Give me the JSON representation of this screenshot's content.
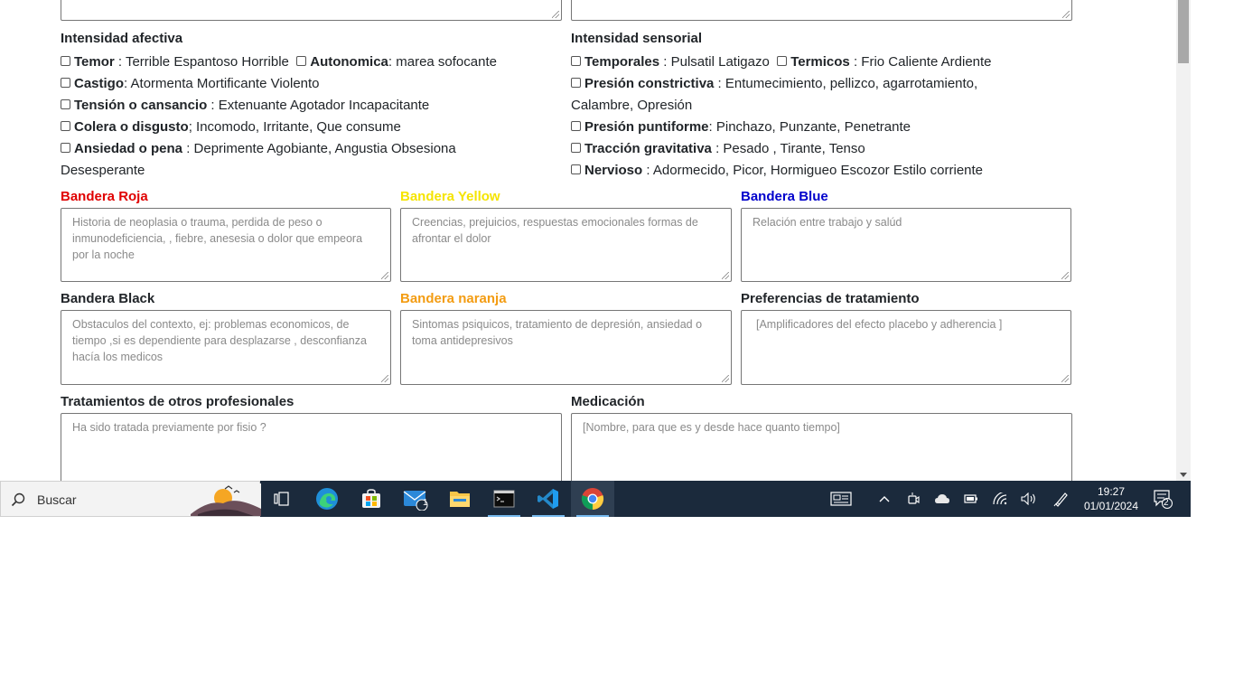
{
  "colors": {
    "red": "#e00000",
    "yellow": "#f5e400",
    "blue": "#0000cc",
    "orange": "#f39c12",
    "taskbar": "#1b2a3c"
  },
  "form": {
    "afectiva": {
      "title": "Intensidad afectiva",
      "items": [
        {
          "name": "Temor",
          "desc": " : Terrible Espantoso Horrible"
        },
        {
          "name": "Autonomica",
          "desc": ": marea sofocante"
        },
        {
          "name": "Castigo",
          "desc": ": Atormenta Mortificante Violento"
        },
        {
          "name": "Tensión o cansancio",
          "desc": " : Extenuante Agotador Incapacitante"
        },
        {
          "name": "Colera o disgusto",
          "desc": "; Incomodo, Irritante, Que consume"
        },
        {
          "name": "Ansiedad o pena",
          "desc": " : Deprimente Agobiante, Angustia Obsesiona"
        }
      ],
      "continuation": "Desesperante"
    },
    "sensorial": {
      "title": "Intensidad sensorial",
      "items": [
        {
          "name": "Temporales",
          "desc": " : Pulsatil Latigazo"
        },
        {
          "name": "Termicos",
          "desc": " : Frio Caliente Ardiente"
        },
        {
          "name": "Presión constrictiva",
          "desc": " : Entumecimiento, pellizco, agarrotamiento,"
        },
        {
          "name": "Presión puntiforme",
          "desc": ": Pinchazo, Punzante, Penetrante"
        },
        {
          "name": "Tracción gravitativa",
          "desc": " : Pesado , Tirante, Tenso"
        },
        {
          "name": "Nervioso",
          "desc": " : Adormecido, Picor, Hormigueo Escozor Estilo corriente"
        }
      ],
      "continuation": "Calambre, Opresión"
    },
    "bandera_roja": {
      "label": "Bandera Roja",
      "placeholder": "Historia de neoplasia o trauma, perdida de peso o inmunodeficiencia, , fiebre, anesesia o dolor que empeora por la noche"
    },
    "bandera_yellow": {
      "label": "Bandera Yellow",
      "placeholder": "Creencias, prejuicios, respuestas emocionales formas de afrontar el dolor"
    },
    "bandera_blue": {
      "label": "Bandera Blue",
      "placeholder": "Relación entre trabajo y salúd"
    },
    "bandera_black": {
      "label": "Bandera Black",
      "placeholder": "Obstaculos del contexto, ej:  problemas economicos, de tiempo ,si es dependiente para desplazarse , desconfianza hacía los medicos"
    },
    "bandera_naranja": {
      "label": "Bandera naranja",
      "placeholder": "Sintomas psiquicos, tratamiento de depresión, ansiedad o toma antidepresivos"
    },
    "preferencias": {
      "label": "Preferencias de tratamiento",
      "placeholder": "[Amplificadores del efecto placebo y adherencia ]"
    },
    "otros_prof": {
      "label": "Tratamientos de otros profesionales",
      "placeholder": "Ha sido tratada previamente por fisio ?"
    },
    "medicacion": {
      "label": "Medicación",
      "placeholder": "[Nombre, para que es y desde hace quanto tiempo]"
    }
  },
  "taskbar": {
    "search_placeholder": "Buscar",
    "mail_badge": "1",
    "time": "19:27",
    "date": "01/01/2024",
    "notifications_badge": "2"
  }
}
